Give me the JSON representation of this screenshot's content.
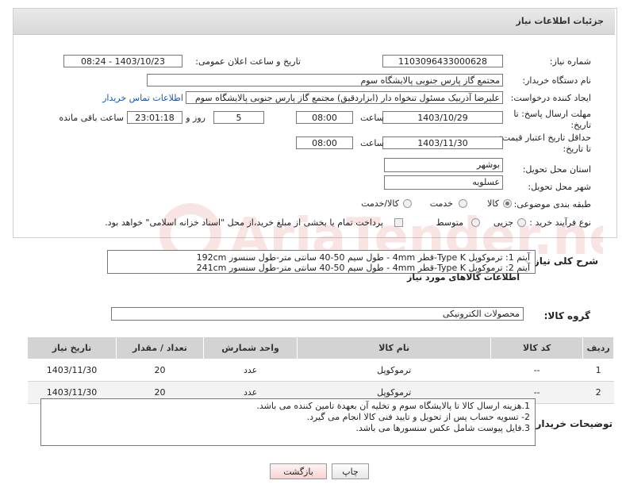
{
  "header": {
    "title": "جزئیات اطلاعات نیاز"
  },
  "fields": {
    "need_number_label": "شماره نیاز:",
    "need_number": "1103096433000628",
    "announce_label": "تاریخ و ساعت اعلان عمومی:",
    "announce_value": "1403/10/23 - 08:24",
    "buyer_org_label": "نام دستگاه خریدار:",
    "buyer_org": "مجتمع گاز پارس جنوبی  پالایشگاه سوم",
    "creator_label": "ایجاد کننده درخواست:",
    "creator": "علیرضا آذربیک مسئول تنخواه دار  (ابزاردقیق) مجتمع گاز پارس جنوبی  پالایشگاه سوم",
    "contact_link": "اطلاعات تماس خریدار",
    "reply_deadline_label": "مهلت ارسال پاسخ: تا تاریخ:",
    "reply_date": "1403/10/29",
    "time_label": "ساعت",
    "reply_time": "08:00",
    "days_value": "5",
    "days_label": "روز و",
    "remaining_time": "23:01:18",
    "remaining_label": "ساعت باقی مانده",
    "price_validity_label": "حداقل تاریخ اعتبار قیمت: تا تاریخ:",
    "price_date": "1403/11/30",
    "price_time_label": "ساعت",
    "price_time": "08:00",
    "province_label": "استان محل تحویل:",
    "province": "بوشهر",
    "city_label": "شهر محل تحویل:",
    "city": "عسلویه",
    "category_label": "طبقه بندی موضوعی:",
    "category_options": [
      "کالا",
      "خدمت",
      "کالا/خدمت"
    ],
    "process_label": "نوع فرآیند خرید :",
    "process_options": [
      "جزیی",
      "متوسط"
    ],
    "payment_note": "پرداخت تمام یا بخشی از مبلغ خرید،از محل \"اسناد خزانه اسلامی\" خواهد بود."
  },
  "description": {
    "label": "شرح کلی نیاز:",
    "lines": [
      "آیتم 1: ترموکوپل Type K-قطر 4mm - طول سیم 50-40 سانتی متر-طول سنسور 192cm",
      "آیتم 2: ترموکوپل Type K-قطر 4mm - طول سیم 50-40 سانتی متر-طول سنسور 241cm"
    ]
  },
  "items_section": {
    "title": "اطلاعات کالاهای مورد نیاز",
    "group_label": "گروه کالا:",
    "group_value": "محصولات الکترونیکی",
    "columns": [
      "ردیف",
      "کد کالا",
      "نام کالا",
      "واحد شمارش",
      "تعداد / مقدار",
      "تاریخ نیاز"
    ],
    "rows": [
      [
        "1",
        "--",
        "ترموکوپل",
        "عدد",
        "20",
        "1403/11/30"
      ],
      [
        "2",
        "--",
        "ترموکوپل",
        "عدد",
        "20",
        "1403/11/30"
      ]
    ]
  },
  "notes": {
    "label": "توضیحات خریدار:",
    "lines": [
      "1.هزینه ارسال کالا تا پالایشگاه سوم و تخلیه آن بعهدة تامین کننده می باشد.",
      "2- تسویه حساب پس از تحویل و تایید فنی کالا انجام می گیرد.",
      "3.فایل پیوست شامل عکس سنسورها می باشد."
    ]
  },
  "buttons": {
    "print": "چاپ",
    "back": "بازگشت"
  },
  "watermark_text": "AriaTender.neT"
}
